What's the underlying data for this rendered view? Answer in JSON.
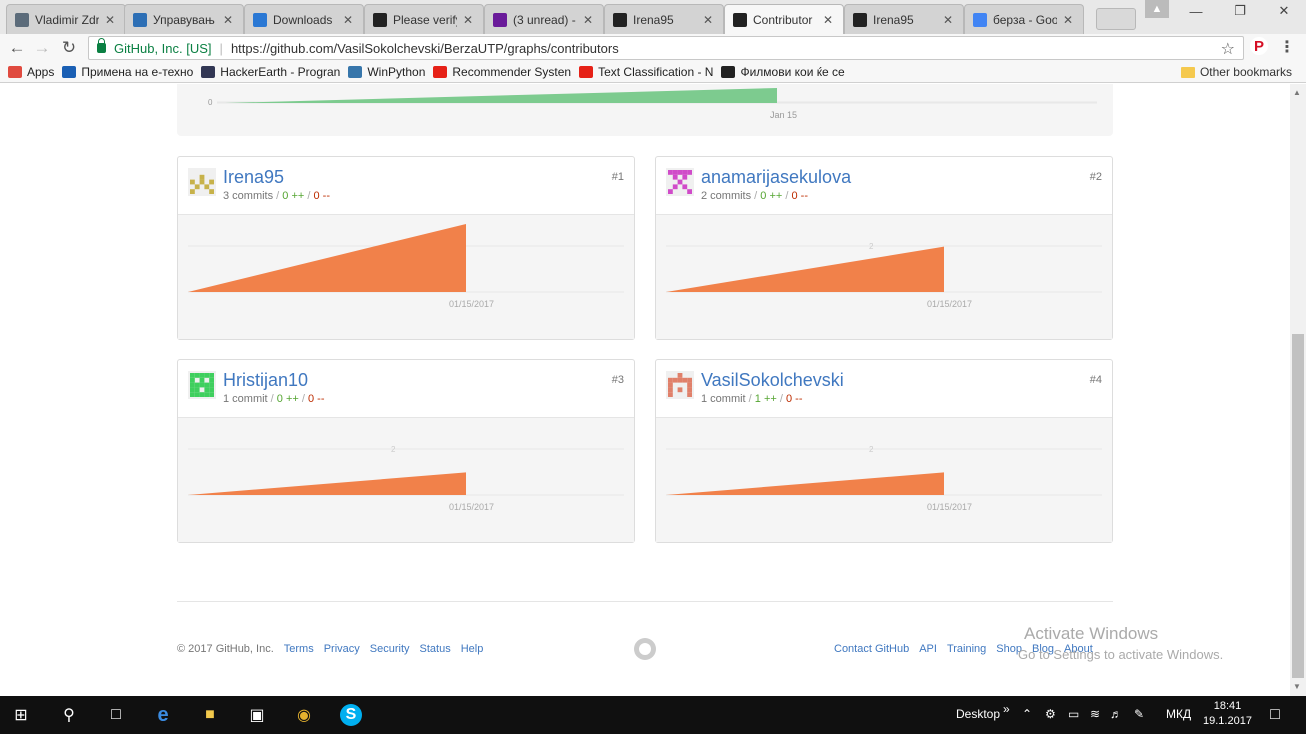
{
  "browser": {
    "tabs": [
      {
        "title": "Vladimir Zdr",
        "icon": "zdravkov-icon",
        "color": "#5b6b7a"
      },
      {
        "title": "Управувањ",
        "icon": "moodle-icon",
        "color": "#2d6fb5"
      },
      {
        "title": "Downloads",
        "icon": "downloads-icon",
        "color": "#2a78d4"
      },
      {
        "title": "Please verify",
        "icon": "github-icon",
        "color": "#222222"
      },
      {
        "title": "(3 unread) -",
        "icon": "mail-icon",
        "color": "#6a1b9a"
      },
      {
        "title": "Irena95",
        "icon": "github-icon",
        "color": "#222222"
      },
      {
        "title": "Contributor",
        "icon": "github-icon",
        "color": "#222222"
      },
      {
        "title": "Irena95",
        "icon": "github-icon",
        "color": "#222222"
      },
      {
        "title": "берза - Goo",
        "icon": "google-icon",
        "color": "#4285f4"
      }
    ],
    "active_tab": 6,
    "omnibox": {
      "secure_label": "GitHub, Inc. [US]",
      "url": "https://github.com/VasilSokolchevski/BerzaUTP/graphs/contributors"
    },
    "bookmarks": [
      {
        "label": "Apps",
        "icon": "apps-icon",
        "color": "#e04a3f"
      },
      {
        "label": "Примена на е-техно",
        "icon": "io-icon",
        "color": "#1a5fb4"
      },
      {
        "label": "HackerEarth - Progran",
        "icon": "hackerearth-icon",
        "color": "#323754"
      },
      {
        "label": "WinPython",
        "icon": "python-icon",
        "color": "#3776ab"
      },
      {
        "label": "Recommender Systen",
        "icon": "youtube-icon",
        "color": "#e62117"
      },
      {
        "label": "Text Classification - N",
        "icon": "youtube-icon",
        "color": "#e62117"
      },
      {
        "label": "Филмови кои ќе се",
        "icon": "f-icon",
        "color": "#222222"
      }
    ],
    "other_bookmarks": "Other bookmarks"
  },
  "main_graph": {
    "y_tick": "0",
    "x_label": "Jan 15",
    "fill_color": "#7dcb8f"
  },
  "contributors": [
    {
      "rank": "#1",
      "name": "Irena95",
      "commits": "3 commits",
      "additions": "0 ++",
      "deletions": "0 --",
      "date": "01/15/2017",
      "ytick": "",
      "level": 1.0,
      "avatar_color": "#c7b24a"
    },
    {
      "rank": "#2",
      "name": "anamarijasekulova",
      "commits": "2 commits",
      "additions": "0 ++",
      "deletions": "0 --",
      "date": "01/15/2017",
      "ytick": "2",
      "level": 0.667,
      "avatar_color": "#d04bc9"
    },
    {
      "rank": "#3",
      "name": "Hristijan10",
      "commits": "1 commit",
      "additions": "0 ++",
      "deletions": "0 --",
      "date": "01/15/2017",
      "ytick": "2",
      "level": 0.333,
      "avatar_color": "#3fcf5e"
    },
    {
      "rank": "#4",
      "name": "VasilSokolchevski",
      "commits": "1 commit",
      "additions": "1 ++",
      "deletions": "0 --",
      "date": "01/15/2017",
      "ytick": "2",
      "level": 0.333,
      "avatar_color": "#e0806a"
    }
  ],
  "chart_color": "#f1814a",
  "footer": {
    "copyright": "© 2017 GitHub, Inc.",
    "left_links": [
      "Terms",
      "Privacy",
      "Security",
      "Status",
      "Help"
    ],
    "right_links": [
      "Contact GitHub",
      "API",
      "Training",
      "Shop",
      "Blog",
      "About"
    ]
  },
  "watermark": {
    "line1": "Activate Windows",
    "line2": "Go to Settings to activate Windows."
  },
  "taskbar": {
    "desktop_label": "Desktop",
    "language": "МКД",
    "time": "18:41",
    "date": "19.1.2017"
  }
}
